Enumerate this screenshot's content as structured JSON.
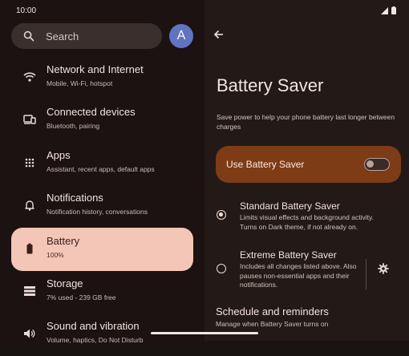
{
  "status_bar": {
    "time": "10:00"
  },
  "search": {
    "placeholder": "Search"
  },
  "avatar": {
    "initial": "A"
  },
  "sidebar": {
    "items": [
      {
        "title": "Network and Internet",
        "subtitle": "Mobile, Wi-Fi, hotspot",
        "icon": "wifi-icon"
      },
      {
        "title": "Connected devices",
        "subtitle": "Bluetooth, pairing",
        "icon": "devices-icon"
      },
      {
        "title": "Apps",
        "subtitle": "Assistant, recent apps, default apps",
        "icon": "apps-grid-icon"
      },
      {
        "title": "Notifications",
        "subtitle": "Notification history, conversations",
        "icon": "bell-icon"
      },
      {
        "title": "Battery",
        "subtitle": "100%",
        "icon": "battery-icon",
        "active": true
      },
      {
        "title": "Storage",
        "subtitle": "7% used - 239 GB free",
        "icon": "storage-icon"
      },
      {
        "title": "Sound and vibration",
        "subtitle": "Volume, haptics, Do Not Disturb",
        "icon": "volume-icon"
      }
    ]
  },
  "detail": {
    "title": "Battery Saver",
    "description": "Save power to help your phone battery last longer between charges",
    "toggle_label": "Use Battery Saver",
    "toggle_on": false,
    "options": [
      {
        "title": "Standard Battery Saver",
        "subtitle": "Limits visual effects and background activity. Turns on Dark theme, if not already on.",
        "selected": true
      },
      {
        "title": "Extreme Battery Saver",
        "subtitle": "Includes all changes listed above. Also pauses non-essential apps and their notifications.",
        "selected": false
      }
    ],
    "schedule_title": "Schedule and reminders",
    "schedule_subtitle": "Manage when Battery Saver turns on"
  },
  "colors": {
    "accent": "#7d3c16",
    "active_item": "#f3c6b7",
    "avatar": "#5f74c3"
  }
}
